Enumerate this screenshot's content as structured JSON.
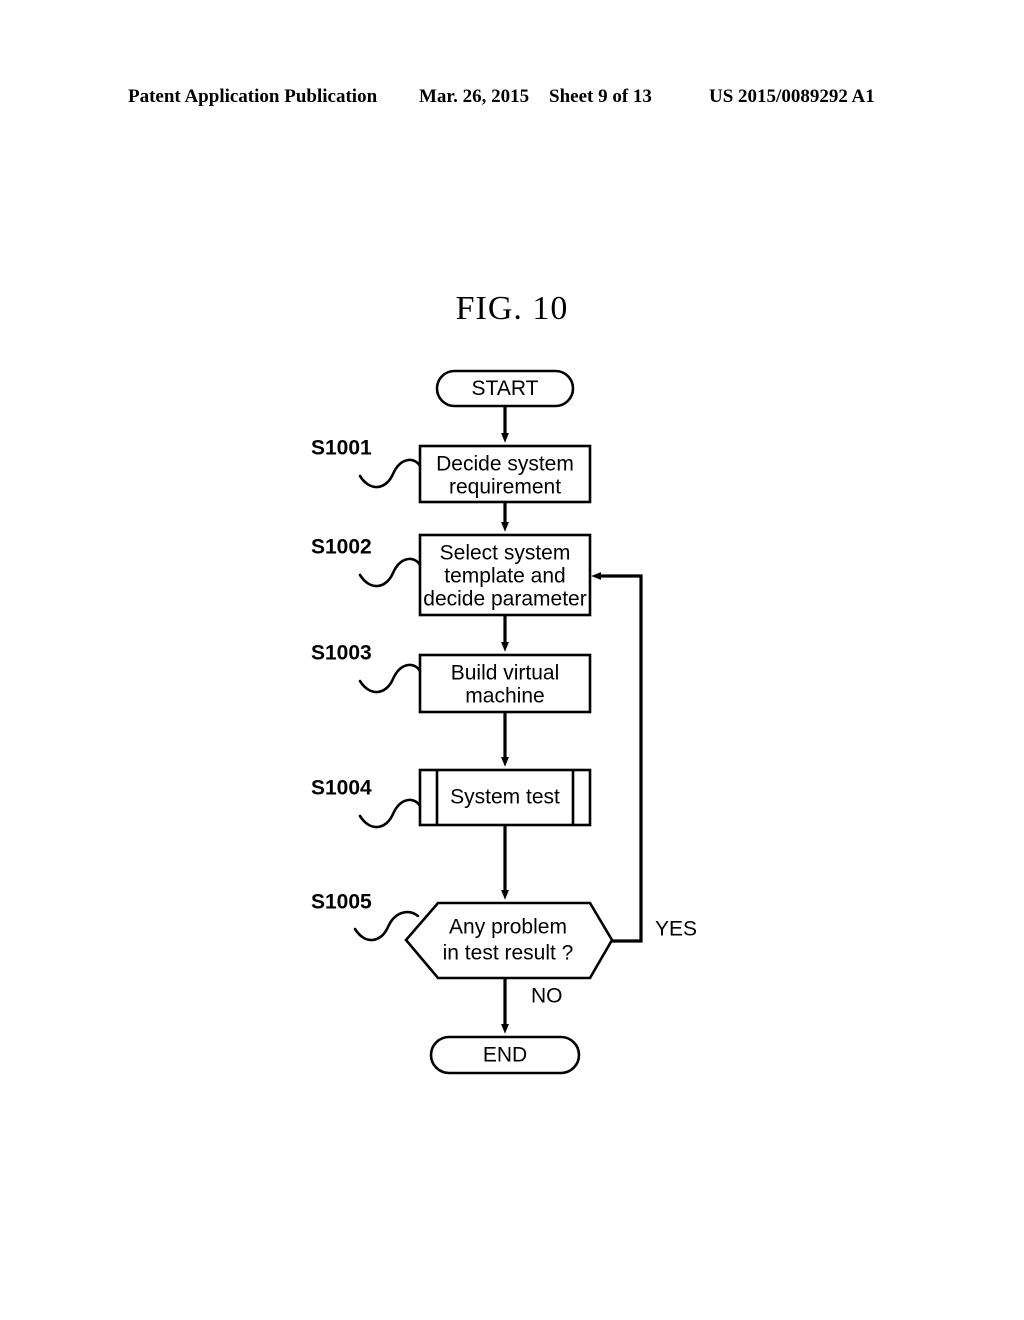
{
  "header": {
    "publication": "Patent Application Publication",
    "date": "Mar. 26, 2015",
    "sheet": "Sheet 9 of 13",
    "patent_number": "US 2015/0089292 A1"
  },
  "figure": {
    "title": "FIG. 10"
  },
  "flowchart": {
    "start_label": "START",
    "end_label": "END",
    "branch_yes": "YES",
    "branch_no": "NO",
    "steps": [
      {
        "id": "S1001",
        "ref_label": "S1001",
        "shape": "process",
        "lines": [
          "Decide system",
          "requirement"
        ]
      },
      {
        "id": "S1002",
        "ref_label": "S1002",
        "shape": "process",
        "lines": [
          "Select system",
          "template and",
          "decide parameter"
        ]
      },
      {
        "id": "S1003",
        "ref_label": "S1003",
        "shape": "process",
        "lines": [
          "Build virtual",
          "machine"
        ]
      },
      {
        "id": "S1004",
        "ref_label": "S1004",
        "shape": "predefined-process",
        "lines": [
          "System test"
        ]
      },
      {
        "id": "S1005",
        "ref_label": "S1005",
        "shape": "decision",
        "lines": [
          "Any problem",
          "in test result ?"
        ]
      }
    ]
  },
  "colors": {
    "ink": "#000000",
    "paper": "#ffffff"
  }
}
